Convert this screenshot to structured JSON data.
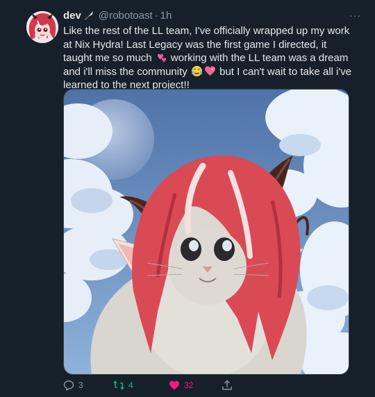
{
  "tweet": {
    "display_name": "dev",
    "handle": "@robotoast",
    "separator": "·",
    "time": "1h",
    "more": "···",
    "text_parts": {
      "p1": "Like the rest of the LL team, I've officially wrapped up my work at Nix Hydra! Last Legacy was the first game I directed, it taught me so much",
      "p2": " working with the LL team was a dream and i'll miss the community ",
      "p3": " but I can't wait to take all i've learned to the next project!!"
    },
    "emoji_icons": [
      "knife-icon",
      "two-hearts-emoji",
      "crying-face-emoji",
      "sparkling-heart-emoji"
    ]
  },
  "actions": {
    "reply_count": "3",
    "retweet_count": "4",
    "like_count": "32"
  },
  "colors": {
    "background": "#15202b",
    "text": "#e7e9ea",
    "muted": "#8b98a5",
    "retweet": "#00ba7c",
    "like": "#f91880"
  }
}
